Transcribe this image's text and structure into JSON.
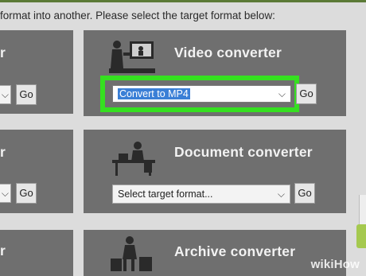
{
  "instruction": "format into another. Please select the target format below:",
  "left_column": {
    "row1": {
      "title_fragment": "r",
      "select_chevron": "⌵",
      "go_label": "Go"
    },
    "row2": {
      "title_fragment": "r",
      "select_chevron": "⌵",
      "go_label": "Go"
    },
    "row3": {
      "title_fragment": "r"
    }
  },
  "video_card": {
    "title": "Video converter",
    "select_value": "Convert to MP4",
    "select_chevron": "⌵",
    "go_label": "Go",
    "icon": "film-camera-icon"
  },
  "document_card": {
    "title": "Document converter",
    "select_placeholder": "Select target format...",
    "select_chevron": "⌵",
    "go_label": "Go",
    "icon": "desk-writer-icon"
  },
  "archive_card": {
    "title": "Archive converter",
    "icon": "archive-worker-icon"
  },
  "watermark": {
    "part1": "wiki",
    "part2": "How"
  },
  "colors": {
    "highlight": "#35e020",
    "card": "#6f6f6f",
    "selected_text_bg": "#3a7fd6"
  }
}
